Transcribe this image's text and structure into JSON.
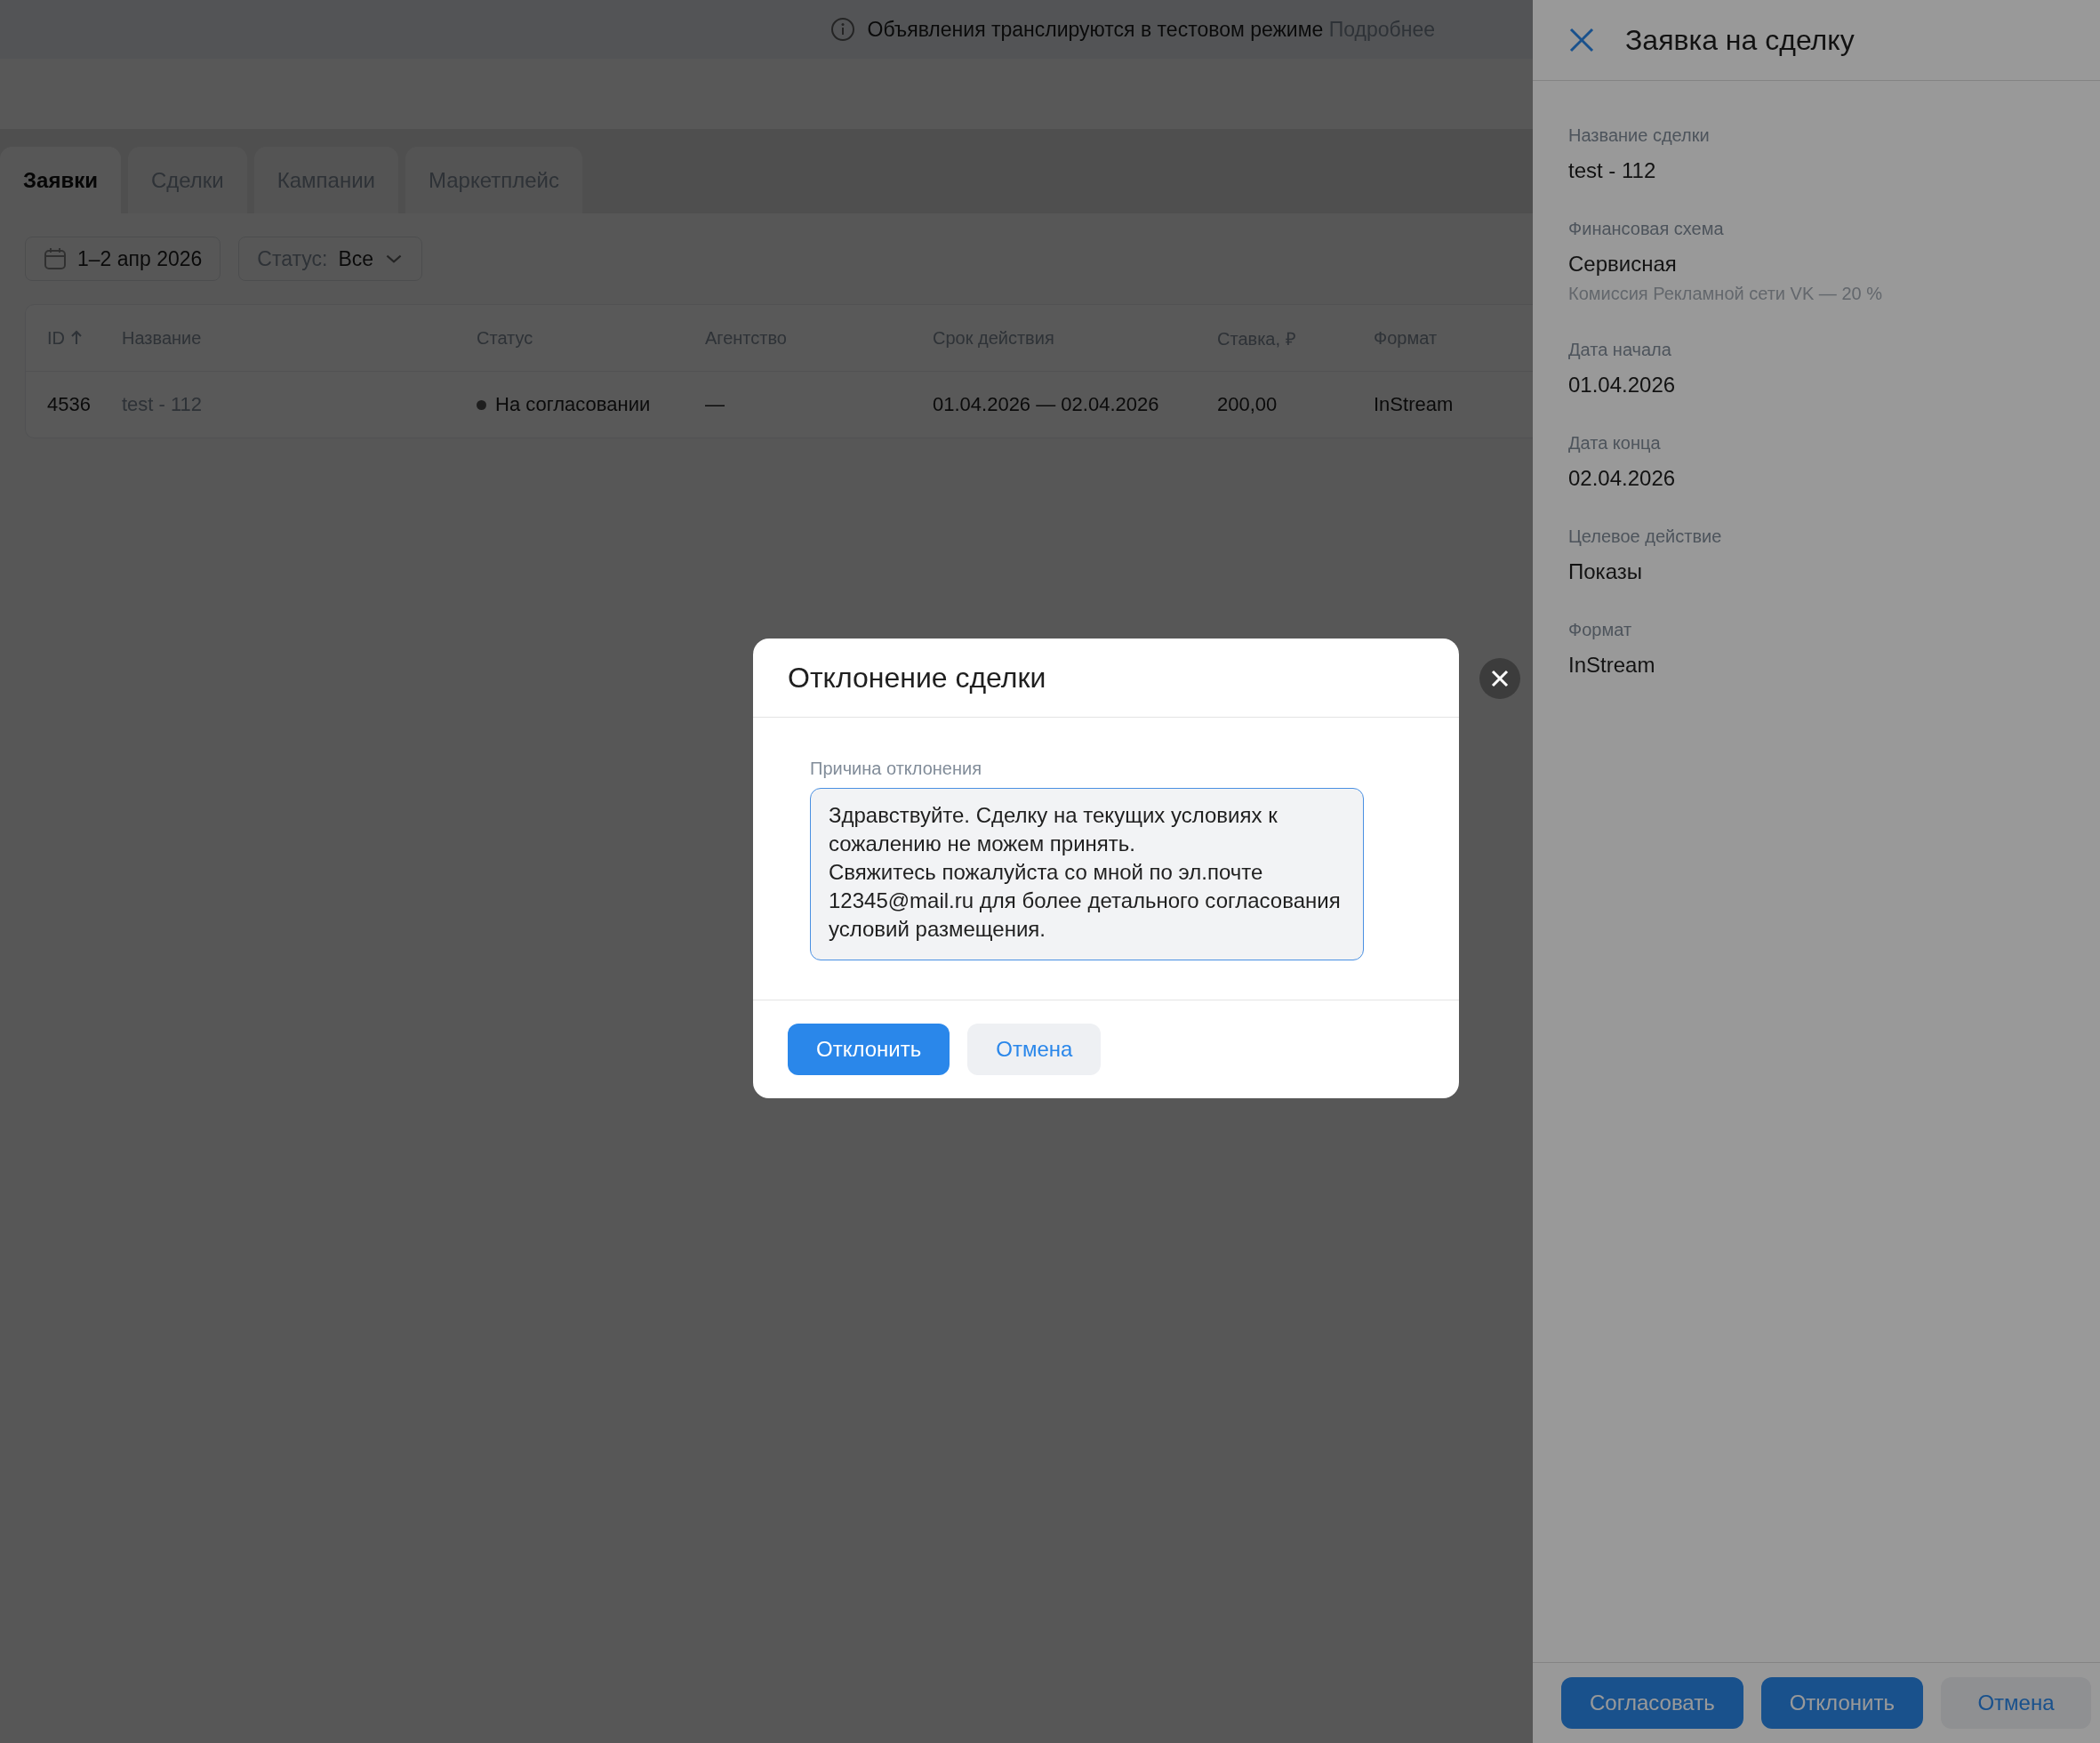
{
  "banner": {
    "text": "Объявления транслируются в тестовом режиме",
    "link": "Подробнее"
  },
  "tabs": [
    {
      "label": "Заявки",
      "selected": true
    },
    {
      "label": "Сделки",
      "selected": false
    },
    {
      "label": "Кампании",
      "selected": false
    },
    {
      "label": "Маркетплейс",
      "selected": false
    }
  ],
  "filters": {
    "date": "1–2 апр 2026",
    "status_label": "Статус:",
    "status_value": "Все"
  },
  "table": {
    "columns": [
      {
        "label": "ID",
        "sorted": true
      },
      {
        "label": "Название",
        "sorted": false
      },
      {
        "label": "Статус",
        "sorted": false
      },
      {
        "label": "Агентство",
        "sorted": false
      },
      {
        "label": "Срок действия",
        "sorted": false
      },
      {
        "label": "Ставка, ₽",
        "sorted": false
      },
      {
        "label": "Формат",
        "sorted": false
      }
    ],
    "rows": [
      {
        "cells": [
          "4536",
          "test - 112",
          "На согласовании",
          "—",
          "01.04.2026 — 02.04.2026",
          "200,00",
          "InStream"
        ]
      }
    ]
  },
  "drawer": {
    "title": "Заявка на сделку",
    "fields": [
      {
        "label": "Название сделки",
        "value": "test - 112"
      },
      {
        "label": "Финансовая схема",
        "value": "Сервисная",
        "note": "Комиссия Рекламной сети VK — 20 %"
      },
      {
        "label": "Дата начала",
        "value": "01.04.2026"
      },
      {
        "label": "Дата конца",
        "value": "02.04.2026"
      },
      {
        "label": "Целевое действие",
        "value": "Показы"
      },
      {
        "label": "Формат",
        "value": "InStream"
      }
    ],
    "buttons": [
      {
        "label": "Согласовать",
        "kind": "primary"
      },
      {
        "label": "Отклонить",
        "kind": "primary"
      },
      {
        "label": "Отмена",
        "kind": "secondary"
      }
    ]
  },
  "modal": {
    "title": "Отклонение сделки",
    "field_label": "Причина отклонения",
    "field_value": "Здравствуйте. Сделку на текущих условиях к сожалению не можем принять.\nСвяжитесь пожалуйста со мной по эл.почте 12345@mail.ru для более детального согласования условий размещения.",
    "buttons": [
      {
        "label": "Отклонить",
        "kind": "primary"
      },
      {
        "label": "Отмена",
        "kind": "secondary"
      }
    ]
  }
}
